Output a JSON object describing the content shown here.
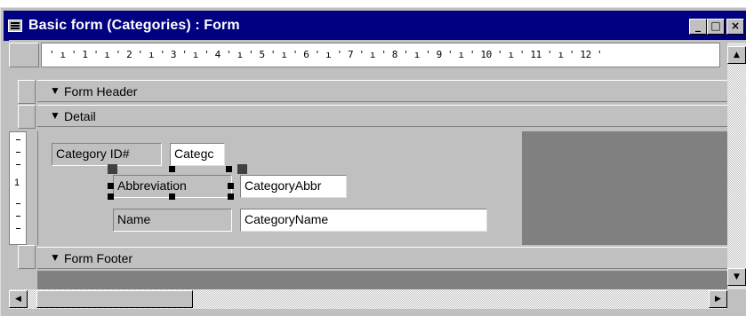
{
  "window": {
    "title": "Basic form (Categories) : Form",
    "minimize_glyph": "_",
    "maximize_glyph": "□",
    "close_glyph": "×"
  },
  "ruler": {
    "text": "' ı ' 1 ' ı ' 2 ' ı ' 3 ' ı ' 4 ' ı ' 5 ' ı ' 6 ' ı ' 7 ' ı ' 8 ' ı ' 9 ' ı ' 10 ' ı ' 11 ' ı ' 12 '"
  },
  "vertical_ruler": {
    "mark": "1"
  },
  "sections": {
    "header": {
      "label": "Form Header"
    },
    "detail": {
      "label": "Detail"
    },
    "footer": {
      "label": "Form Footer"
    }
  },
  "controls": {
    "category_id": {
      "label": "Category ID#",
      "value": "Categc"
    },
    "abbreviation": {
      "label": "Abbreviation",
      "value": "CategoryAbbr"
    },
    "name": {
      "label": "Name",
      "value": "CategoryName"
    }
  },
  "icons": {
    "section_arrow": "section-marker-icon",
    "scroll_up": "▲",
    "scroll_down": "▼",
    "scroll_left": "◀",
    "scroll_right": "▶"
  },
  "colors": {
    "titlebar": "#000080",
    "face": "#c0c0c0",
    "dark": "#808080"
  }
}
